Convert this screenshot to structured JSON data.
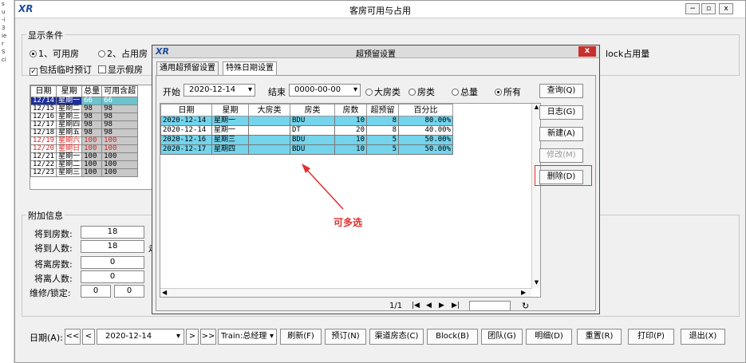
{
  "edge": {
    "glyphs": [
      "s",
      "u",
      "",
      "-i",
      "3",
      "ie",
      "r",
      "S",
      "ci"
    ]
  },
  "window": {
    "title": "客房可用与占用",
    "logo": "XR",
    "min": "−",
    "max": "▫",
    "close": "x"
  },
  "display": {
    "group_label": "显示条件",
    "radio1": "1、可用房",
    "radio2": "2、占用房",
    "check1": "包括临时预订",
    "check2": "显示假房",
    "block_text": "lock占用量"
  },
  "grid": {
    "headers": [
      "日期",
      "星期",
      "总量",
      "可用含超"
    ],
    "rows": [
      {
        "date": "12/14",
        "week": "星期一",
        "total": "66",
        "avail": "66",
        "sel": true,
        "red": false
      },
      {
        "date": "12/15",
        "week": "星期二",
        "total": "98",
        "avail": "98",
        "sel": false,
        "red": false
      },
      {
        "date": "12/16",
        "week": "星期三",
        "total": "98",
        "avail": "98",
        "sel": false,
        "red": false
      },
      {
        "date": "12/17",
        "week": "星期四",
        "total": "98",
        "avail": "98",
        "sel": false,
        "red": false
      },
      {
        "date": "12/18",
        "week": "星期五",
        "total": "98",
        "avail": "98",
        "sel": false,
        "red": false
      },
      {
        "date": "12/19",
        "week": "星期六",
        "total": "100",
        "avail": "100",
        "sel": false,
        "red": true
      },
      {
        "date": "12/20",
        "week": "星期日",
        "total": "100",
        "avail": "100",
        "sel": false,
        "red": true
      },
      {
        "date": "12/21",
        "week": "星期一",
        "total": "100",
        "avail": "100",
        "sel": false,
        "red": false
      },
      {
        "date": "12/22",
        "week": "星期二",
        "total": "100",
        "avail": "100",
        "sel": false,
        "red": false
      },
      {
        "date": "12/23",
        "week": "星期三",
        "total": "100",
        "avail": "100",
        "sel": false,
        "red": false
      }
    ]
  },
  "extra": {
    "group_label": "附加信息",
    "arr_rooms_label": "将到房数:",
    "arr_rooms": "18",
    "arr_people_label": "将到人数:",
    "arr_people": "18",
    "arr_people_suffix": "走",
    "dep_rooms_label": "将离房数:",
    "dep_rooms": "0",
    "dep_people_label": "将离人数:",
    "dep_people": "0",
    "maint_label": "维修/锁定:",
    "maint1": "0",
    "maint2": "0"
  },
  "bottom": {
    "date_label": "日期(A):",
    "first": "<<",
    "prev": "<",
    "date": "2020-12-14",
    "next": ">",
    "last": ">>",
    "user": "Train:总经理",
    "buttons": [
      "刷新(F)",
      "预订(N)",
      "渠道房态(C)",
      "Block(B)",
      "团队(G)",
      "明细(D)",
      "重置(R)",
      "打印(P)",
      "退出(X)"
    ]
  },
  "dialog": {
    "logo": "XR",
    "title": "超预留设置",
    "close": "x",
    "tabs": [
      "通用超预留设置",
      "特殊日期设置"
    ],
    "start_label": "开始",
    "start_date": "2020-12-14",
    "end_label": "结束",
    "end_date": "0000-00-00",
    "filters": [
      "大房类",
      "房类",
      "总量",
      "所有"
    ],
    "headers": [
      "日期",
      "星期",
      "大房类",
      "房类",
      "房数",
      "超预留",
      "百分比"
    ],
    "rows": [
      {
        "date": "2020-12-14",
        "week": "星期一",
        "big": "",
        "type": "BDU",
        "count": "10",
        "over": "8",
        "pct": "80.00%",
        "hl": true
      },
      {
        "date": "2020-12-14",
        "week": "星期一",
        "big": "",
        "type": "DT",
        "count": "20",
        "over": "8",
        "pct": "40.00%",
        "hl": false
      },
      {
        "date": "2020-12-16",
        "week": "星期三",
        "big": "",
        "type": "BDU",
        "count": "10",
        "over": "5",
        "pct": "50.00%",
        "hl": true
      },
      {
        "date": "2020-12-17",
        "week": "星期四",
        "big": "",
        "type": "BDU",
        "count": "10",
        "over": "5",
        "pct": "50.00%",
        "hl": true
      }
    ],
    "buttons": [
      "查询(Q)",
      "日志(G)",
      "新建(A)",
      "修改(M)",
      "删除(D)"
    ],
    "pager": "1/1"
  },
  "annotation": "可多选",
  "colors": {
    "selected_row": "#1d2f9c",
    "highlight_row": "#73d4ec",
    "annotation": "#e03030"
  }
}
